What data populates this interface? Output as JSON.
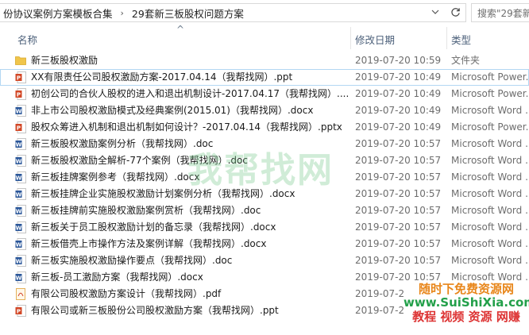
{
  "address_bar": {
    "crumb_1": "份协议案例方案模板合集",
    "crumb_2": "29套新三板股权问题方案",
    "separator": "›"
  },
  "search": {
    "placeholder": "搜索\"29套新"
  },
  "columns": {
    "name": "名称",
    "date": "修改日期",
    "type": "类型"
  },
  "files": [
    {
      "icon": "folder-icon",
      "name": "新三板股权激励",
      "date": "2019-07-20 10:59",
      "type": "文件夹"
    },
    {
      "icon": "powerpoint-icon",
      "name": "XX有限责任公司股权激励方案-2017.04.14（我帮找网）.ppt",
      "date": "2019-07-20 10:49",
      "type": "Microsoft Power..."
    },
    {
      "icon": "powerpoint-icon",
      "name": "初创公司的合伙人股权的进入和退出机制设计-2017.04.17（我帮找网）....",
      "date": "2019-07-20 10:49",
      "type": "Microsoft Power..."
    },
    {
      "icon": "word-icon",
      "name": "非上市公司股权激励模式及经典案例(2015.01)（我帮找网）.docx",
      "date": "2019-07-20 10:49",
      "type": "Microsoft Word ..."
    },
    {
      "icon": "powerpoint-icon",
      "name": "股权众筹进入机制和退出机制如何设计？-2017.04.14（我帮找网）.pptx",
      "date": "2019-07-20 10:49",
      "type": "Microsoft Power..."
    },
    {
      "icon": "word-icon",
      "name": "新三板股权激励案例分析（我帮找网）.doc",
      "date": "2019-07-20 10:57",
      "type": "Microsoft Word ..."
    },
    {
      "icon": "word-icon",
      "name": "新三板股权激励全解析-77个案例（我帮找网）.doc",
      "date": "2019-07-20 10:57",
      "type": "Microsoft Word ..."
    },
    {
      "icon": "word-icon",
      "name": "新三板挂牌案例参考（我帮找网）.docx",
      "date": "2019-07-20 10:57",
      "type": "Microsoft Word ..."
    },
    {
      "icon": "word-icon",
      "name": "新三板挂牌企业实施股权激励计划案例分析（我帮找网）.docx",
      "date": "2019-07-20 10:57",
      "type": "Microsoft Word ..."
    },
    {
      "icon": "word-icon",
      "name": "新三板挂牌前实施股权激励案例赏析（我帮找网）.doc",
      "date": "2019-07-20 10:57",
      "type": "Microsoft Word ..."
    },
    {
      "icon": "word-icon",
      "name": "新三板关于员工股权激励计划的备忘录（我帮找网）.docx",
      "date": "2019-07-20 10:57",
      "type": "Microsoft Word ..."
    },
    {
      "icon": "word-icon",
      "name": "新三板借壳上市操作方法及案例详解（我帮找网）.docx",
      "date": "2019-07-20 10:57",
      "type": "Microsoft Word ..."
    },
    {
      "icon": "word-icon",
      "name": "新三板实施股权激励操作要点（我帮找网）.doc",
      "date": "2019-07-20 10:57",
      "type": "Microsoft Word ..."
    },
    {
      "icon": "word-icon",
      "name": "新三板-员工激励方案（我帮找网）.docx",
      "date": "2019-07-20 10:57",
      "type": "Microsoft Word ..."
    },
    {
      "icon": "pdf-icon",
      "name": "有限公司股权激励方案设计（我帮找网）.pdf",
      "date": "2019-07-2",
      "type": ""
    },
    {
      "icon": "powerpoint-icon",
      "name": "有限公司或新三板股份公司股权激励方案（我帮找网）.ppt",
      "date": "2019-07-2",
      "type": ""
    }
  ],
  "watermarks": {
    "center": "我帮找网",
    "badge_line_1": "随时下免费资源网",
    "badge_line_2": "www.SuiShiXia.com",
    "badge_line_3": "教程 视频 资源 网赚"
  },
  "colors": {
    "folder": "#f0c54b",
    "powerpoint": "#d24726",
    "word": "#2b579a",
    "pdf": "#e1a94a",
    "header_text": "#4c607a",
    "selection_border": "#b3d7f3"
  }
}
